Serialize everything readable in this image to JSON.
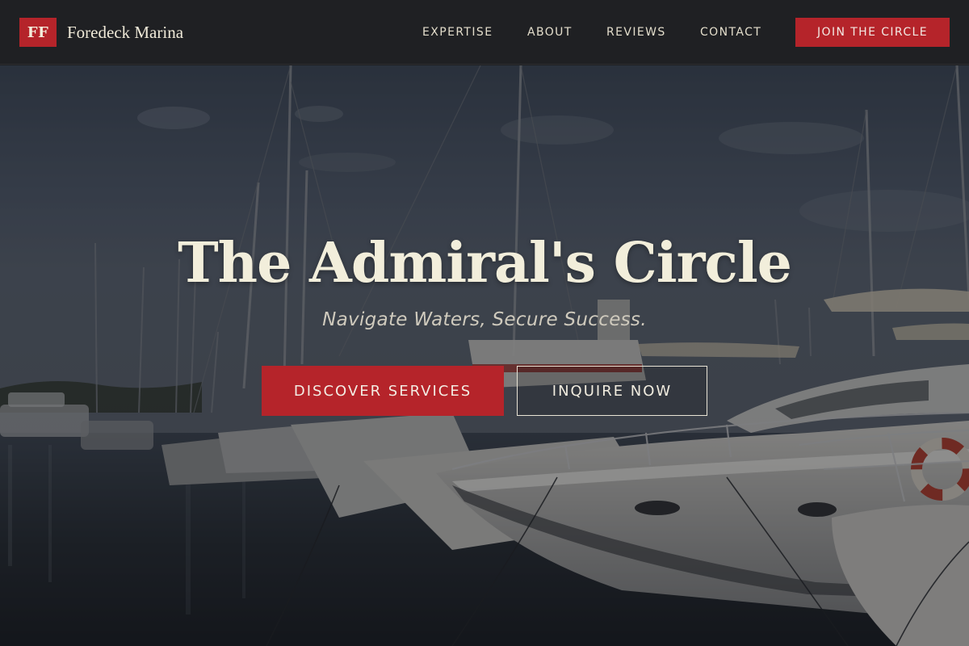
{
  "brand": {
    "logo_text": "FF",
    "name": "Foredeck Marina"
  },
  "nav": {
    "links": [
      {
        "label": "EXPERTISE"
      },
      {
        "label": "ABOUT"
      },
      {
        "label": "REVIEWS"
      },
      {
        "label": "CONTACT"
      }
    ],
    "cta_label": "JOIN THE CIRCLE"
  },
  "hero": {
    "title": "The Admiral's Circle",
    "subtitle": "Navigate Waters, Secure Success.",
    "primary_button": "DISCOVER SERVICES",
    "secondary_button": "INQUIRE NOW",
    "background_image": "marina-yachts-photo"
  },
  "colors": {
    "accent_red": "#b5242a",
    "nav_background": "#1f2023",
    "cream_text": "#f2eedb"
  }
}
